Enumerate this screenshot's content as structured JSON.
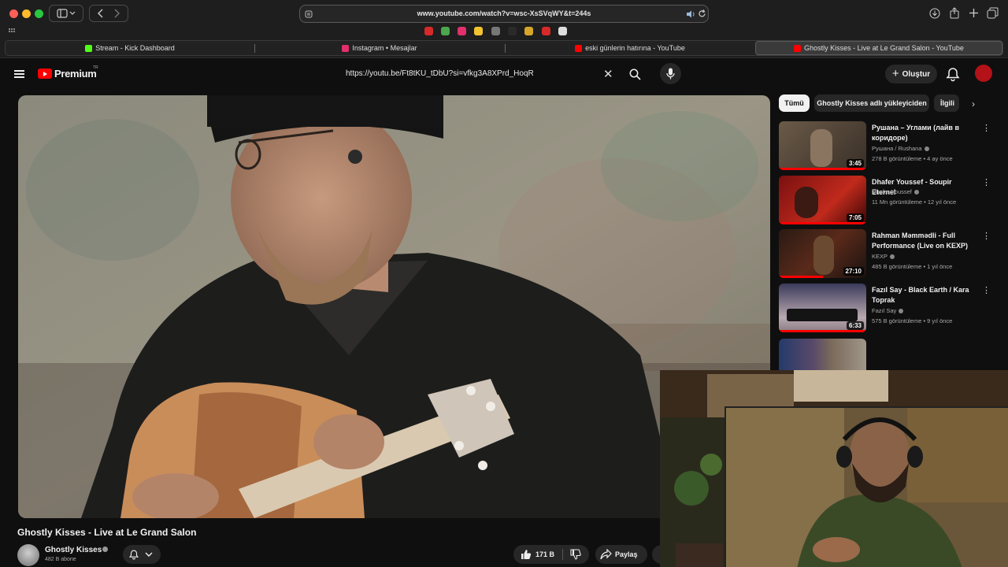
{
  "browser": {
    "url": "www.youtube.com/watch?v=wsc-XsSVqWY&t=244s",
    "tabs": [
      {
        "label": "Stream - Kick Dashboard",
        "icon_color": "#53fc18",
        "active": false
      },
      {
        "label": "Instagram • Mesajlar",
        "icon_color": "#e1306c",
        "active": false
      },
      {
        "label": "eski günlerin hatırına - YouTube",
        "icon_color": "#ff0000",
        "active": false
      },
      {
        "label": "Ghostly Kisses - Live at Le Grand Salon - YouTube",
        "icon_color": "#ff0000",
        "active": true
      }
    ],
    "favorites_colors": [
      "#d62a2a",
      "#4ca64c",
      "#e1306c",
      "#f2c230",
      "#777777",
      "#2a2a2a",
      "#d6a52a",
      "#d62a2a",
      "#dddddd"
    ]
  },
  "youtube": {
    "logo_text": "Premium",
    "logo_region": "TR",
    "search_value": "https://youtu.be/Ft8tKU_tDbU?si=vfkg3A8XPrd_HoqR",
    "create_label": "Oluştur",
    "video": {
      "title": "Ghostly Kisses - Live at Le Grand Salon",
      "channel": "Ghostly Kisses",
      "subscribers": "482 B abone",
      "likes": "171 B",
      "share_label": "Paylaş"
    },
    "chips": [
      "Tümü",
      "Ghostly Kisses adlı yükleyiciden",
      "İlgili"
    ],
    "recommendations": [
      {
        "title": "Рушана – Углами (лайв в коридоре)",
        "channel": "Рушана / Rushana",
        "meta": "278 B görüntüleme • 4 ay önce",
        "duration": "3:45",
        "progress": 1.0
      },
      {
        "title": "Dhafer Youssef - Soupir Eternel",
        "channel": "Dhafer Youssef",
        "meta": "11 Mn görüntüleme • 12 yıl önce",
        "duration": "7:05",
        "progress": 1.0
      },
      {
        "title": "Rahman Məmmədli - Full Performance (Live on KEXP)",
        "channel": "KEXP",
        "meta": "485 B görüntüleme • 1 yıl önce",
        "duration": "27:10",
        "progress": 0.5
      },
      {
        "title": "Fazıl Say - Black Earth / Kara Toprak",
        "channel": "Fazıl Say",
        "meta": "575 B görüntüleme • 9 yıl önce",
        "duration": "6:33",
        "progress": 1.0
      }
    ]
  }
}
